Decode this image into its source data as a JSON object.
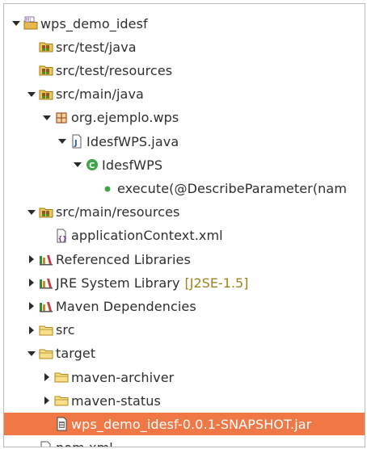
{
  "tree": {
    "items": [
      {
        "label": "wps_demo_idesf",
        "icon": "maven-project-icon",
        "expander": "expanded",
        "level": 0
      },
      {
        "label": "src/test/java",
        "icon": "source-folder-icon",
        "expander": "none",
        "level": 1
      },
      {
        "label": "src/test/resources",
        "icon": "source-folder-icon",
        "expander": "none",
        "level": 1
      },
      {
        "label": "src/main/java",
        "icon": "source-folder-icon",
        "expander": "expanded",
        "level": 1
      },
      {
        "label": "org.ejemplo.wps",
        "icon": "package-icon",
        "expander": "expanded",
        "level": 2
      },
      {
        "label": "IdesfWPS.java",
        "icon": "java-file-icon",
        "expander": "expanded",
        "level": 3
      },
      {
        "label": "IdesfWPS",
        "icon": "class-icon",
        "expander": "expanded",
        "level": 4
      },
      {
        "label": "execute(@DescribeParameter(nam",
        "icon": "public-method-icon",
        "expander": "none",
        "level": 5
      },
      {
        "label": "src/main/resources",
        "icon": "source-folder-icon",
        "expander": "expanded",
        "level": 1
      },
      {
        "label": "applicationContext.xml",
        "icon": "xml-file-icon",
        "expander": "none",
        "level": 2
      },
      {
        "label": "Referenced Libraries",
        "icon": "library-icon",
        "expander": "collapsed",
        "level": 1
      },
      {
        "label": "JRE System Library",
        "decoration": "[J2SE-1.5]",
        "icon": "library-icon",
        "expander": "collapsed",
        "level": 1
      },
      {
        "label": "Maven Dependencies",
        "icon": "library-icon",
        "expander": "collapsed",
        "level": 1
      },
      {
        "label": "src",
        "icon": "folder-icon",
        "expander": "collapsed",
        "level": 1
      },
      {
        "label": "target",
        "icon": "folder-icon",
        "expander": "expanded",
        "level": 1
      },
      {
        "label": "maven-archiver",
        "icon": "folder-icon",
        "expander": "collapsed",
        "level": 2
      },
      {
        "label": "maven-status",
        "icon": "folder-icon",
        "expander": "collapsed",
        "level": 2
      },
      {
        "label": "wps_demo_idesf-0.0.1-SNAPSHOT.jar",
        "icon": "jar-file-icon",
        "expander": "none",
        "level": 2,
        "selected": true
      },
      {
        "label": "pom.xml",
        "icon": "maven-pom-icon",
        "expander": "none",
        "level": 1
      }
    ]
  },
  "colors": {
    "selection": "#f07746",
    "decoration": "#9a8420",
    "text": "#2e2e2e"
  }
}
